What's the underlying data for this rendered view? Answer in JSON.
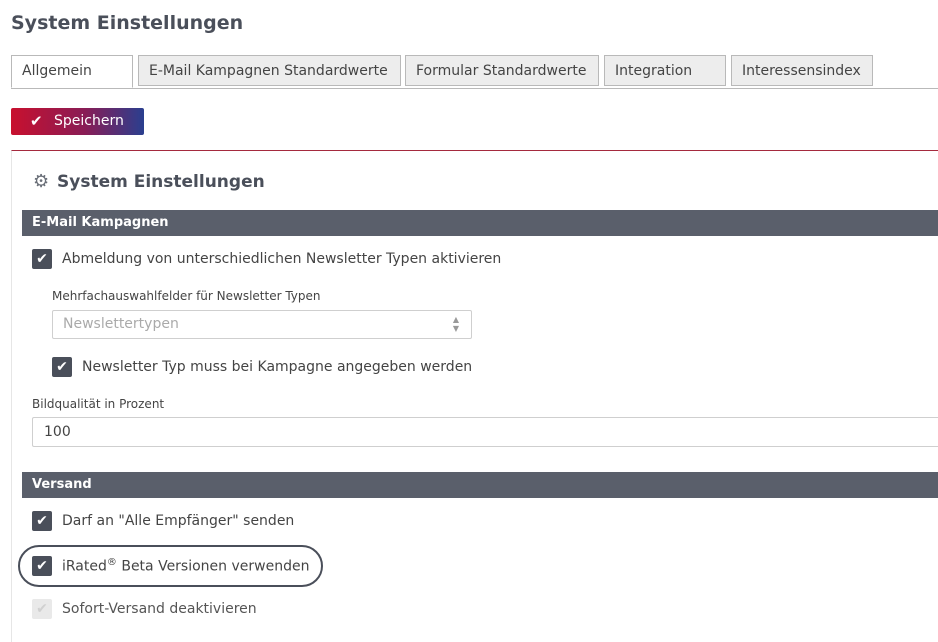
{
  "page_title": "System Einstellungen",
  "tabs": [
    {
      "label": "Allgemein",
      "active": true
    },
    {
      "label": "E-Mail Kampagnen Standardwerte",
      "active": false
    },
    {
      "label": "Formular Standardwerte",
      "active": false
    },
    {
      "label": "Integration",
      "active": false
    },
    {
      "label": "Interessensindex",
      "active": false
    }
  ],
  "toolbar": {
    "save_label": "Speichern",
    "save_icon": "check-icon"
  },
  "colors": {
    "band": "#5a5f6b",
    "save_gradient_start": "#c8102e",
    "save_gradient_end": "#2a3f8f",
    "accent_line": "#a52a3e"
  },
  "panel": {
    "title": "System Einstellungen",
    "title_icon": "gear-icon",
    "email_section": {
      "heading": "E-Mail Kampagnen",
      "unsubscribe_label": "Abmeldung von unterschiedlichen Newsletter Typen aktivieren",
      "unsubscribe_checked": true,
      "multiselect_label": "Mehrfachauswahlfelder für Newsletter Typen",
      "multiselect_placeholder": "Newslettertypen",
      "type_required_label": "Newsletter Typ muss bei Kampagne angegeben werden",
      "type_required_checked": true,
      "image_quality_label": "Bildqualität in Prozent",
      "image_quality_value": "100"
    },
    "shipping_section": {
      "heading": "Versand",
      "all_recipients_label": "Darf an \"Alle Empfänger\" senden",
      "all_recipients_checked": true,
      "beta_label_prefix": "iRated",
      "beta_label_reg": "®",
      "beta_label_suffix": " Beta Versionen verwenden",
      "beta_checked": true,
      "instant_label": "Sofort-Versand deaktivieren",
      "instant_checked": true,
      "instant_disabled": true
    }
  }
}
